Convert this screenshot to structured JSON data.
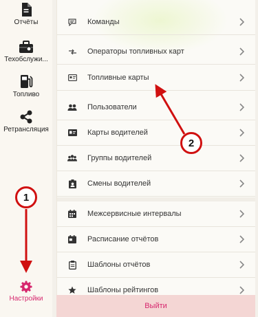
{
  "sidebar": {
    "items": [
      {
        "label": "Отчёты",
        "icon": "document-icon"
      },
      {
        "label": "Техобслужи...",
        "icon": "toolbox-icon"
      },
      {
        "label": "Топливо",
        "icon": "fuel-pump-icon"
      },
      {
        "label": "Ретрансляция",
        "icon": "share-icon"
      },
      {
        "label": "Настройки",
        "icon": "gear-icon",
        "active": true
      }
    ]
  },
  "menu": {
    "items": [
      {
        "label": "Команды",
        "icon": "chat-icon"
      },
      {
        "label": "Операторы топливных карт",
        "icon": "arrows-icon"
      },
      {
        "label": "Топливные карты",
        "icon": "card-icon"
      },
      {
        "label": "Пользователи",
        "icon": "users-icon"
      },
      {
        "label": "Карты водителей",
        "icon": "id-card-icon"
      },
      {
        "label": "Группы водителей",
        "icon": "group-icon"
      },
      {
        "label": "Смены водителей",
        "icon": "badge-icon"
      },
      {
        "label": "Межсервисные интервалы",
        "icon": "calendar-icon"
      },
      {
        "label": "Расписание отчётов",
        "icon": "schedule-icon"
      },
      {
        "label": "Шаблоны отчётов",
        "icon": "clipboard-icon"
      },
      {
        "label": "Шаблоны рейтингов",
        "icon": "star-icon"
      }
    ]
  },
  "logout_label": "Выйти",
  "annotations": {
    "one": "1",
    "two": "2"
  },
  "colors": {
    "accent": "#d6266d",
    "annotation": "#d01010",
    "logout_bg": "#f4d6d4"
  }
}
